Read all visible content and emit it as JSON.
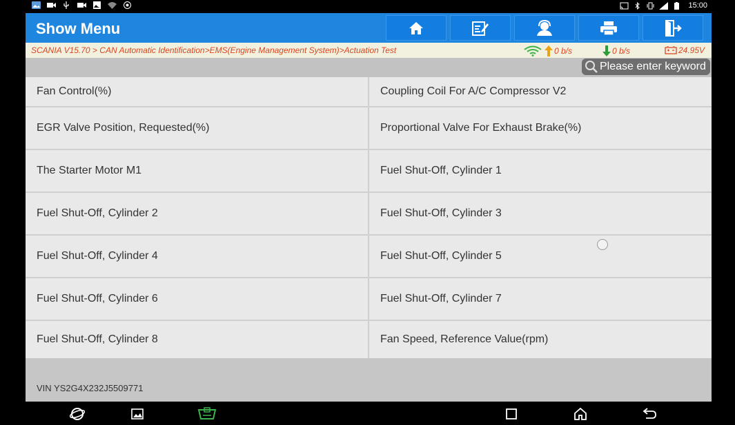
{
  "statusbar": {
    "time": "15:00",
    "left_icons": [
      "gallery-icon",
      "video-icon",
      "usb-icon",
      "camera-icon",
      "image-icon",
      "wifi-icon",
      "settings-icon"
    ],
    "right_icons": [
      "cast-icon",
      "bluetooth-icon",
      "vibrate-icon",
      "signal-icon",
      "battery-icon"
    ]
  },
  "header": {
    "title": "Show Menu",
    "buttons": [
      "home",
      "edit-report",
      "support",
      "print",
      "exit"
    ]
  },
  "breadcrumb": {
    "text": "SCANIA V15.70 > CAN Automatic Identification>EMS(Engine Management System)>Actuation Test",
    "upload_rate": "0 b/s",
    "download_rate": "0 b/s",
    "voltage": "24.95V"
  },
  "search": {
    "placeholder": "Please enter keyword"
  },
  "menu": {
    "rows": [
      [
        "Fan Control(%)",
        "Coupling Coil For A/C Compressor V2"
      ],
      [
        "EGR Valve Position, Requested(%)",
        "Proportional Valve For Exhaust Brake(%)"
      ],
      [
        "The Starter Motor M1",
        "Fuel Shut-Off, Cylinder 1"
      ],
      [
        "Fuel Shut-Off, Cylinder 2",
        "Fuel Shut-Off, Cylinder 3"
      ],
      [
        "Fuel Shut-Off, Cylinder 4",
        "Fuel Shut-Off, Cylinder 5"
      ],
      [
        "Fuel Shut-Off, Cylinder 6",
        "Fuel Shut-Off, Cylinder 7"
      ],
      [
        "Fuel Shut-Off, Cylinder 8",
        "Fan Speed, Reference Value(rpm)"
      ]
    ]
  },
  "footer": {
    "vin": "VIN YS2G4X232J5509771"
  },
  "colors": {
    "header": "#1f86e0",
    "breadcrumb_text": "#d9461f",
    "upload_arrow": "#e8a317",
    "download_arrow": "#2e9e3a",
    "wifi": "#3bb54a"
  }
}
